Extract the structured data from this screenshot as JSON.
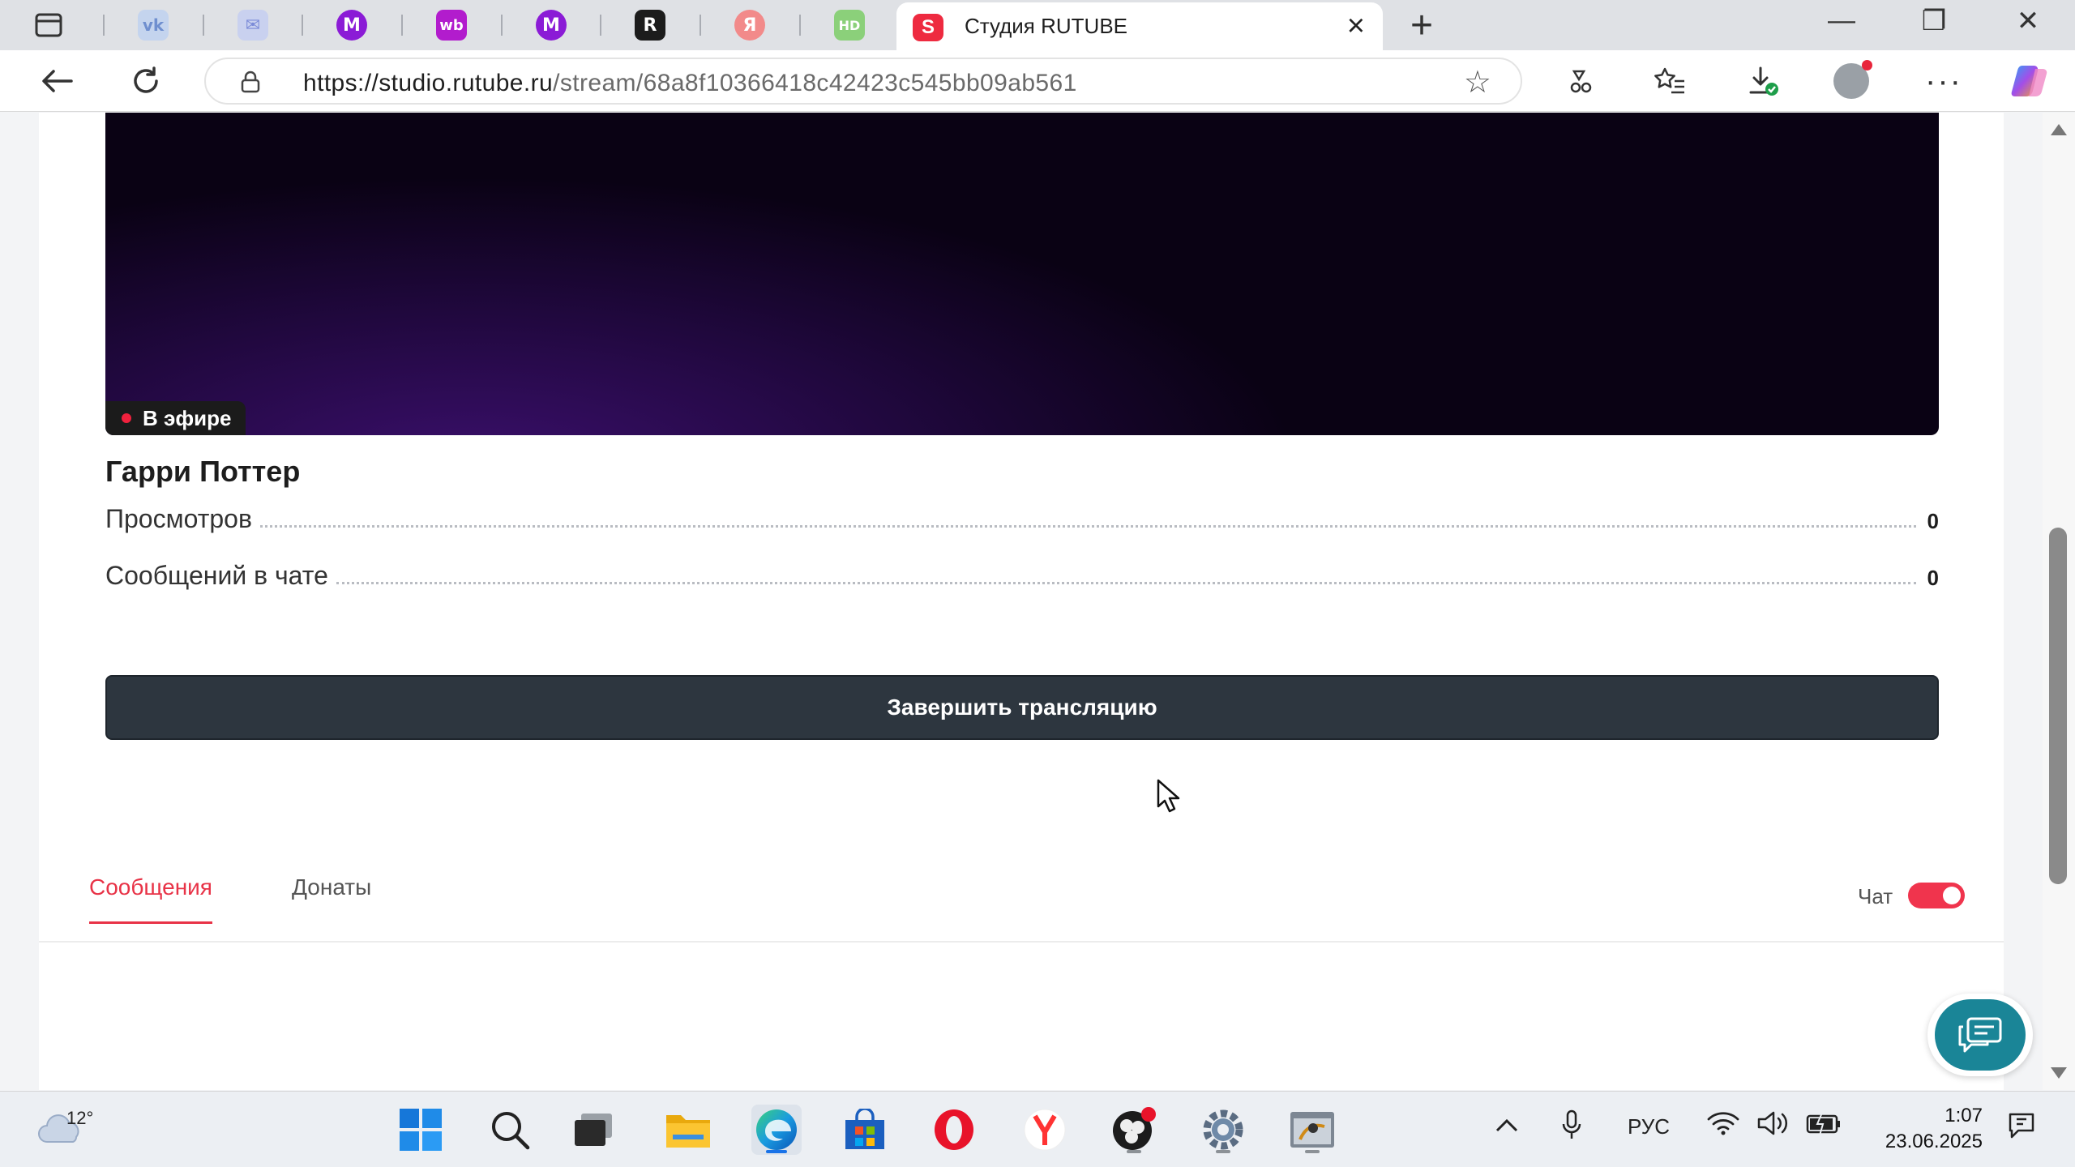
{
  "browser": {
    "tabs": [
      {
        "icon": "vk-icon",
        "glyph": "vk",
        "color": "#c4d4ee"
      },
      {
        "icon": "mail-icon",
        "glyph": "✉",
        "color": "#c9d1ef"
      },
      {
        "icon": "m-icon",
        "glyph": "M",
        "color": "#8b1bd6"
      },
      {
        "icon": "wb-icon",
        "glyph": "wb",
        "color": "#b21ccd"
      },
      {
        "icon": "m-icon",
        "glyph": "M",
        "color": "#8b1bd6"
      },
      {
        "icon": "r-icon",
        "glyph": "R",
        "color": "#1c1c1c"
      },
      {
        "icon": "yandex-icon",
        "glyph": "Я",
        "color": "#f28a8a"
      },
      {
        "icon": "hd-icon",
        "glyph": "HD",
        "color": "#8bd07a"
      }
    ],
    "active_tab": {
      "title": "Студия RUTUBE",
      "icon": "rutube-studio-icon",
      "glyph": "S",
      "color": "#ee2a40"
    },
    "url_host": "https://studio.rutube.ru",
    "url_path": "/stream/68a8f10366418c42423c545bb09ab561"
  },
  "stream": {
    "live_badge": "В эфире",
    "title": "Гарри Поттер",
    "stats": [
      {
        "label": "Просмотров",
        "value": "0"
      },
      {
        "label": "Сообщений в чате",
        "value": "0"
      }
    ],
    "end_button": "Завершить трансляцию"
  },
  "chat": {
    "tabs": [
      {
        "label": "Сообщения",
        "active": true
      },
      {
        "label": "Донаты",
        "active": false
      }
    ],
    "toggle_label": "Чат",
    "toggle_on": true
  },
  "taskbar": {
    "weather_temp": "12°",
    "language": "РУС",
    "time": "1:07",
    "date": "23.06.2025"
  },
  "colors": {
    "accent": "#e83347",
    "end_button_bg": "#2d363f",
    "support_button": "#1a8597"
  }
}
